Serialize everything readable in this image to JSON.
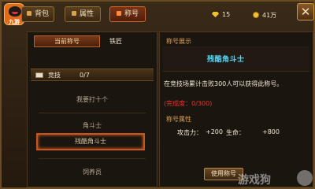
{
  "app": {
    "logo_text": "九游"
  },
  "tabs": [
    {
      "label": "背包"
    },
    {
      "label": "属性"
    },
    {
      "label": "称号"
    }
  ],
  "currency": {
    "gems": "15",
    "gold": "41万"
  },
  "left_panel": {
    "current_title_label": "当前称号",
    "current_title_value": "铁匠",
    "category": {
      "label": "竞技",
      "count": "0/7"
    },
    "items": [
      {
        "label": "我要打十个"
      },
      {
        "label": "角斗士"
      },
      {
        "label": "残酷角斗士"
      },
      {
        "label": "饲养员"
      }
    ]
  },
  "right_panel": {
    "display_title": "称号展示",
    "badge_name": "残酷角斗士",
    "description": "在竞技场累计击败300人可以获得此称号。",
    "progress_text": "(完成度：0/300)",
    "attributes_title": "称号属性",
    "attributes": [
      {
        "label": "攻击力：",
        "value": "+200"
      },
      {
        "label": "生命：",
        "value": "+800"
      }
    ],
    "use_button": "使用称号"
  },
  "watermark": "游戏狗",
  "colors": {
    "accent_orange": "#c9551e",
    "badge_cyan": "#5fd2e6",
    "progress_red": "#e0382a",
    "section_gold": "#d9a25a"
  }
}
